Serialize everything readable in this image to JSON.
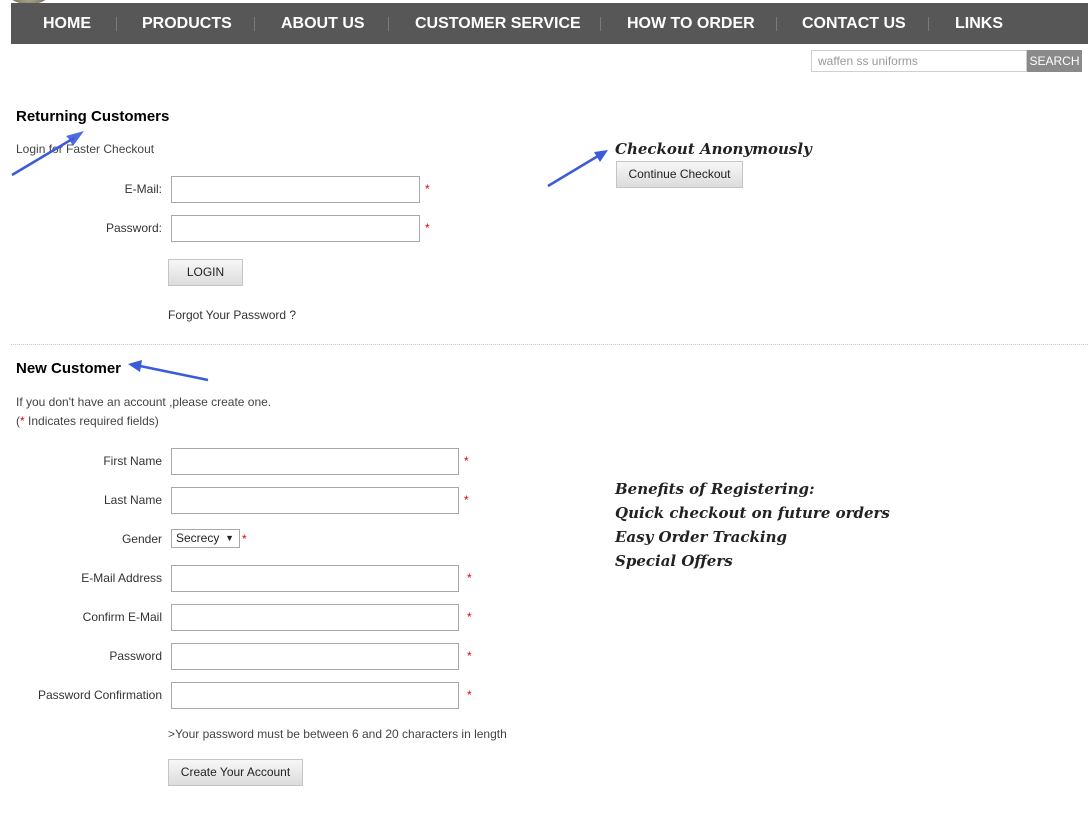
{
  "nav": {
    "items": [
      "HOME",
      "PRODUCTS",
      "ABOUT US",
      "CUSTOMER SERVICE",
      "HOW TO ORDER",
      "CONTACT US",
      "LINKS"
    ]
  },
  "search": {
    "placeholder": "waffen ss uniforms",
    "button_label": "SEARCH"
  },
  "returning": {
    "title": "Returning Customers",
    "subtitle": "Login for Faster Checkout",
    "email_label": "E-Mail:",
    "password_label": "Password:",
    "required_mark": "*",
    "login_button": "LOGIN",
    "forgot_link": "Forgot Your Password ?"
  },
  "anonymous": {
    "title": "Checkout Anonymously",
    "button": "Continue Checkout"
  },
  "new_customer": {
    "title": "New Customer",
    "intro": "If you don't have an account ,please create one.",
    "required_note_open": "(",
    "required_note_star": "*",
    "required_note_rest": " Indicates required fields)",
    "fields": {
      "first_name": "First Name",
      "last_name": "Last Name",
      "gender": "Gender",
      "email": "E-Mail Address",
      "confirm_email": "Confirm E-Mail",
      "password": "Password",
      "password_confirm": "Password Confirmation"
    },
    "gender_selected": "Secrecy",
    "password_hint": ">Your password must be between 6 and 20 characters in length",
    "create_button": "Create Your Account"
  },
  "benefits": {
    "title": "Benefits of Registering:",
    "items": [
      "Quick checkout on future orders",
      "Easy Order Tracking",
      "Special Offers"
    ]
  },
  "colors": {
    "nav_bg": "#575757",
    "required": "#e00000",
    "annotation_arrow": "#3b5bdb"
  }
}
